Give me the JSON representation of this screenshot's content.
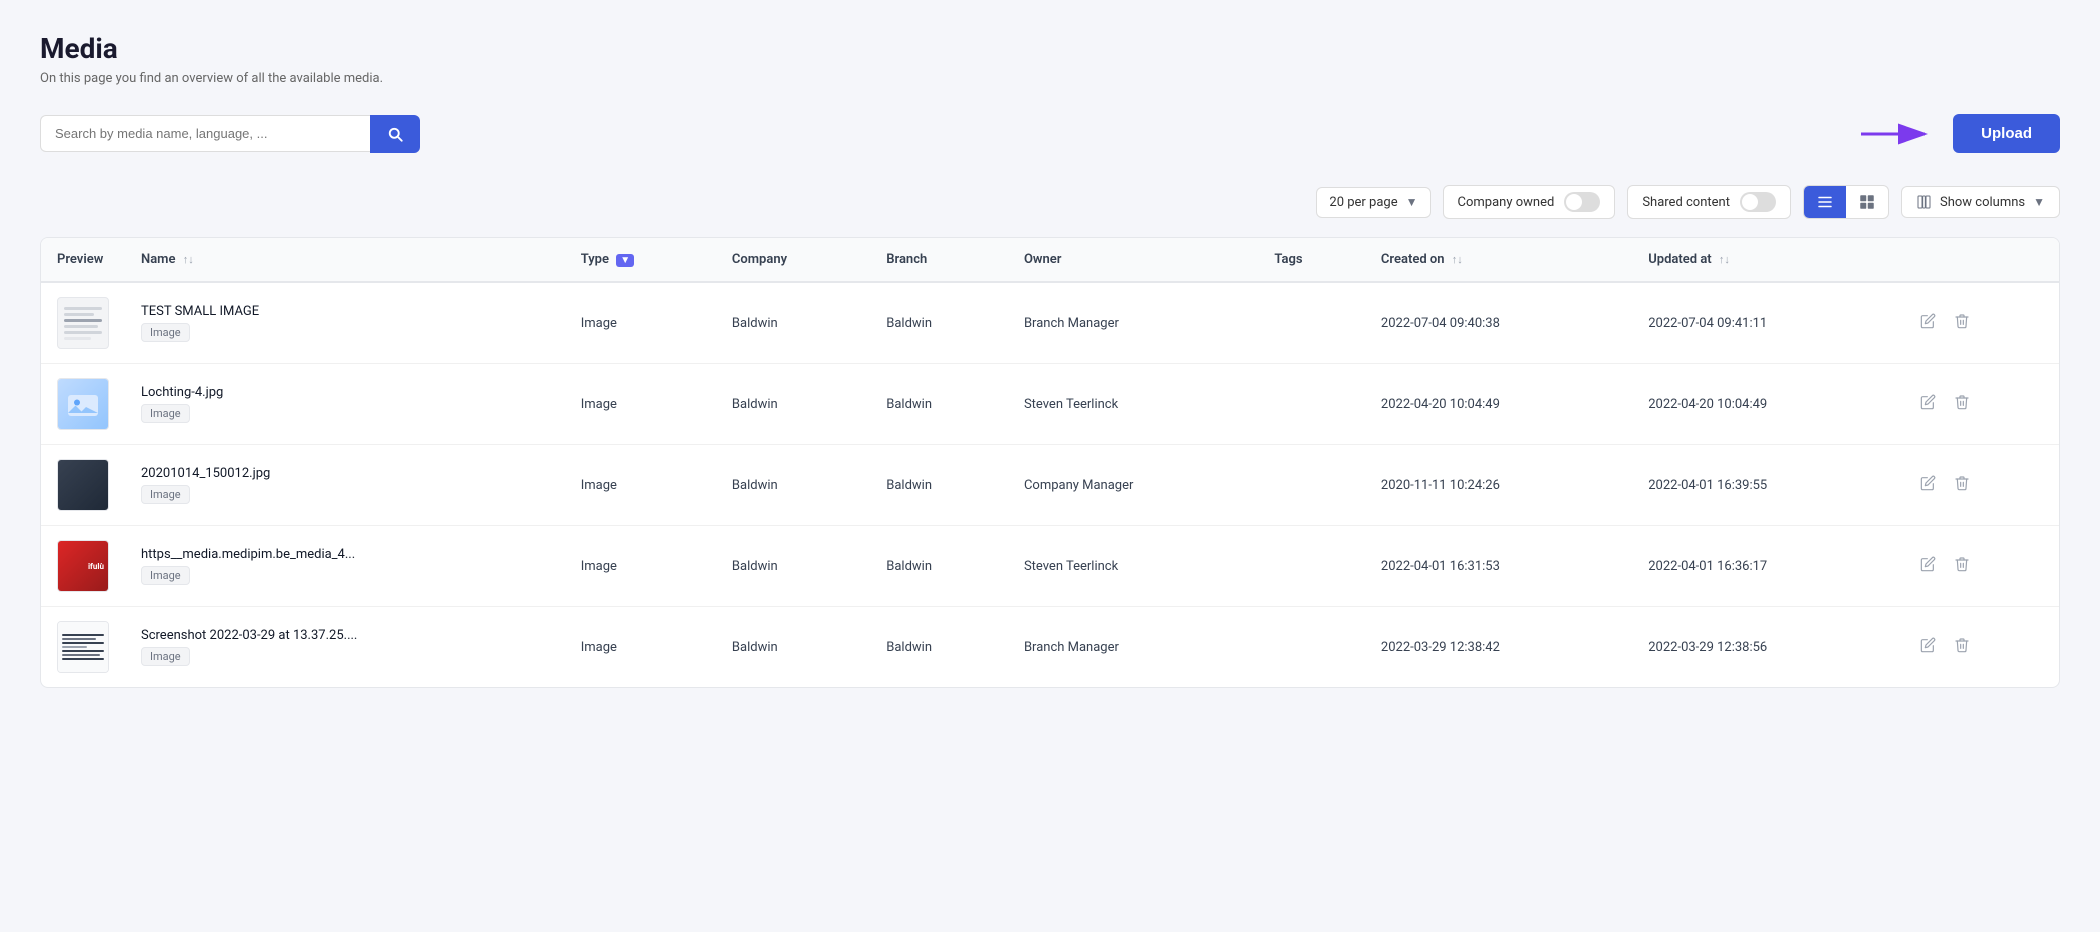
{
  "page": {
    "title": "Media",
    "subtitle": "On this page you find an overview of all the available media."
  },
  "search": {
    "placeholder": "Search by media name, language, ..."
  },
  "upload_btn": "Upload",
  "toolbar": {
    "per_page": "20 per page",
    "company_owned_label": "Company owned",
    "shared_content_label": "Shared content",
    "show_columns_label": "Show columns"
  },
  "table": {
    "headers": [
      {
        "key": "preview",
        "label": "Preview"
      },
      {
        "key": "name",
        "label": "Name"
      },
      {
        "key": "type",
        "label": "Type"
      },
      {
        "key": "company",
        "label": "Company"
      },
      {
        "key": "branch",
        "label": "Branch"
      },
      {
        "key": "owner",
        "label": "Owner"
      },
      {
        "key": "tags",
        "label": "Tags"
      },
      {
        "key": "created_on",
        "label": "Created on"
      },
      {
        "key": "updated_at",
        "label": "Updated at"
      }
    ],
    "rows": [
      {
        "name": "TEST SMALL IMAGE",
        "badge": "Image",
        "type": "Image",
        "company": "Baldwin",
        "branch": "Baldwin",
        "owner": "Branch Manager",
        "tags": "",
        "created_on": "2022-07-04 09:40:38",
        "updated_at": "2022-07-04 09:41:11",
        "thumb_type": "lines"
      },
      {
        "name": "Lochting-4.jpg",
        "badge": "Image",
        "type": "Image",
        "company": "Baldwin",
        "branch": "Baldwin",
        "owner": "Steven Teerlinck",
        "tags": "",
        "created_on": "2022-04-20 10:04:49",
        "updated_at": "2022-04-20 10:04:49",
        "thumb_type": "photo"
      },
      {
        "name": "20201014_150012.jpg",
        "badge": "Image",
        "type": "Image",
        "company": "Baldwin",
        "branch": "Baldwin",
        "owner": "Company Manager",
        "tags": "",
        "created_on": "2020-11-11 10:24:26",
        "updated_at": "2022-04-01 16:39:55",
        "thumb_type": "dark"
      },
      {
        "name": "https__media.medipim.be_media_4...",
        "badge": "Image",
        "type": "Image",
        "company": "Baldwin",
        "branch": "Baldwin",
        "owner": "Steven Teerlinck",
        "tags": "",
        "created_on": "2022-04-01 16:31:53",
        "updated_at": "2022-04-01 16:36:17",
        "thumb_type": "red"
      },
      {
        "name": "Screenshot 2022-03-29 at 13.37.25....",
        "badge": "Image",
        "type": "Image",
        "company": "Baldwin",
        "branch": "Baldwin",
        "owner": "Branch Manager",
        "tags": "",
        "created_on": "2022-03-29 12:38:42",
        "updated_at": "2022-03-29 12:38:56",
        "thumb_type": "lines2"
      }
    ]
  }
}
